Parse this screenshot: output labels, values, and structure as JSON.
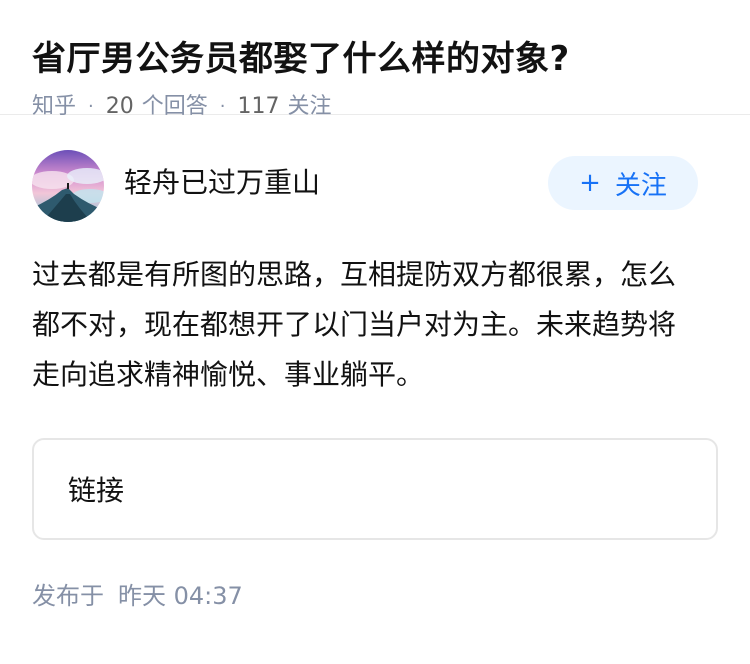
{
  "question": {
    "title": "省厅男公务员都娶了什么样的对象?",
    "source": "知乎",
    "answer_count": "20",
    "answer_label": "个回答",
    "follower_count": "117",
    "follower_label": "关注"
  },
  "answer": {
    "author_name": "轻舟已过万重山",
    "follow_button_label": "关注",
    "content": "过去都是有所图的思路，互相提防双方都很累，怎么都不对，现在都想开了以门当户对为主。未来趋势将走向追求精神愉悦、事业躺平。",
    "link_label": "链接",
    "published_label": "发布于",
    "published_time": "昨天 04:37"
  },
  "colors": {
    "brand_blue": "#1772f6",
    "follow_bg": "#ebf5ff",
    "meta_gray": "#8590a6"
  },
  "icons": {
    "avatar": "avatar-landscape-image",
    "follow": "plus-icon"
  }
}
